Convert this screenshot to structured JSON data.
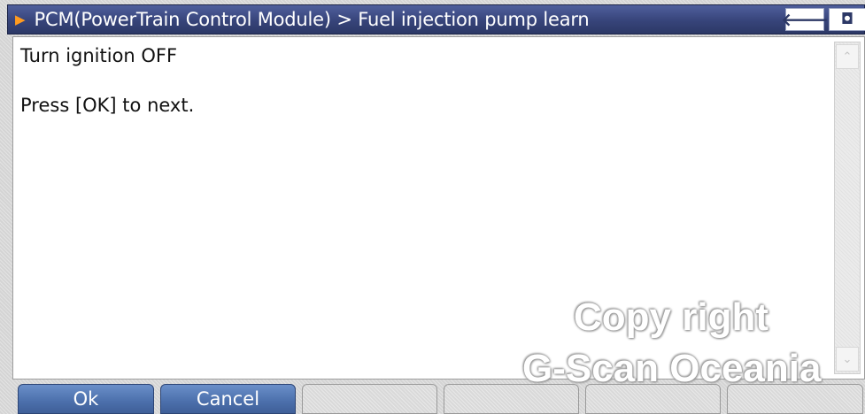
{
  "header": {
    "title": "PCM(PowerTrain Control Module) > Fuel injection pump learn",
    "arrow_icon": "triangle-right-icon",
    "back_icon": "back-arrow-icon",
    "camera_icon": "camera-icon"
  },
  "content": {
    "lines": [
      "Turn ignition OFF",
      "Press [OK] to next."
    ]
  },
  "buttons": [
    "Ok",
    "Cancel",
    "",
    "",
    "",
    ""
  ],
  "watermark": [
    "Copy right",
    "G-Scan Oceania"
  ],
  "colors": {
    "title_bg": "#37447a",
    "accent_arrow": "#ff9b1f",
    "active_button": "#4b6fab"
  }
}
